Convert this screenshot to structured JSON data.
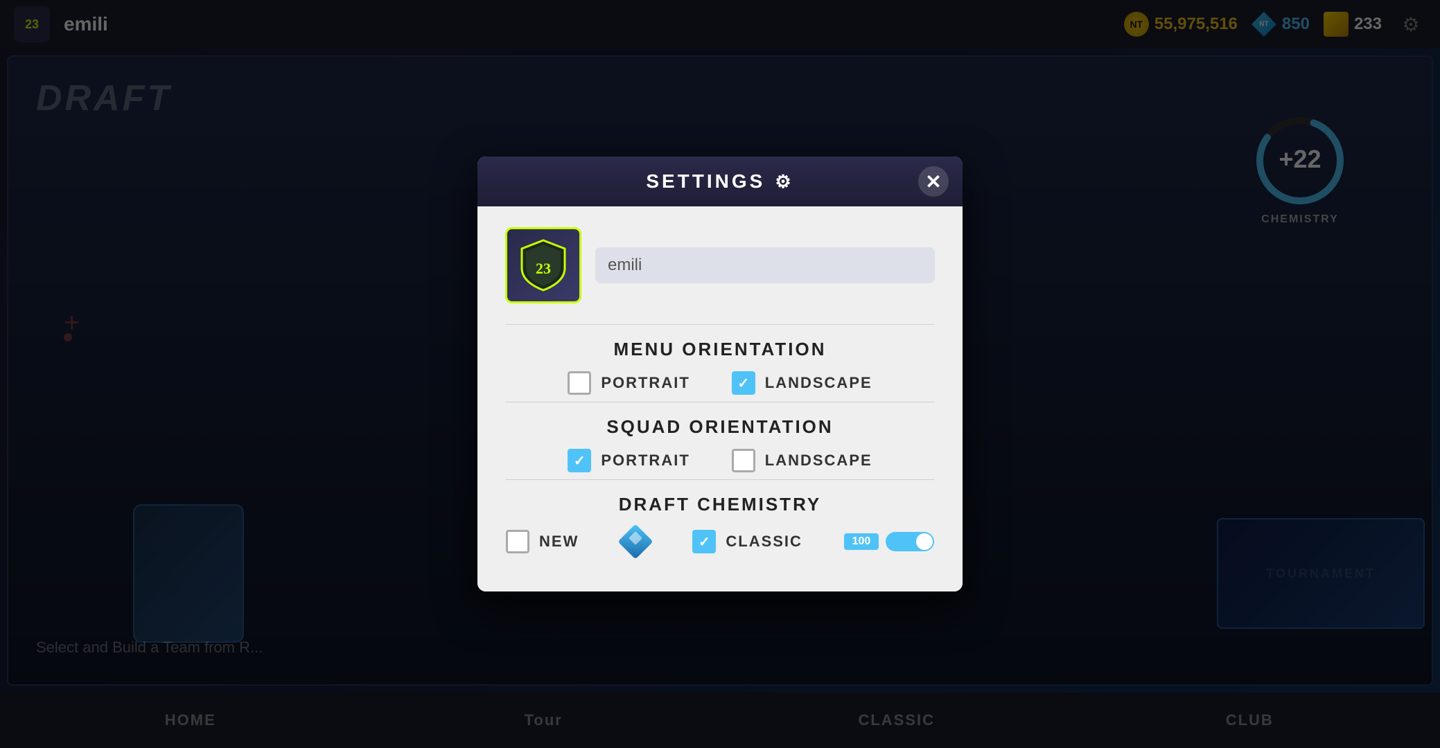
{
  "topbar": {
    "badge_number": "23",
    "username": "emili",
    "coins": "55,975,516",
    "pts": "850",
    "fifa_points": "233"
  },
  "background": {
    "draft_title": "DRAFT",
    "draft_subtitle": "Select and Build a Team from R...",
    "chemistry_value": "+22",
    "chemistry_label": "CHEMISTRY"
  },
  "bottom_nav": {
    "items": [
      {
        "label": "HOME",
        "active": false
      },
      {
        "label": "Tour",
        "active": false
      },
      {
        "label": "CLASSIC",
        "active": false
      },
      {
        "label": "CLUB",
        "active": false
      }
    ]
  },
  "modal": {
    "title": "SETTINGS",
    "close_label": "✕",
    "gear_icon": "⚙",
    "profile": {
      "username_value": "emili",
      "username_placeholder": "emili"
    },
    "menu_orientation": {
      "section_title": "MENU ORIENTATION",
      "portrait": {
        "label": "PORTRAIT",
        "checked": false
      },
      "landscape": {
        "label": "LANDSCAPE",
        "checked": true
      }
    },
    "squad_orientation": {
      "section_title": "SQUAD ORIENTATION",
      "portrait": {
        "label": "PORTRAIT",
        "checked": true
      },
      "landscape": {
        "label": "LANDSCAPE",
        "checked": false
      }
    },
    "draft_chemistry": {
      "section_title": "DRAFT CHEMISTRY",
      "new_option": {
        "label": "NEW",
        "checked": false
      },
      "classic_option": {
        "label": "CLASSIC",
        "checked": true
      },
      "toggle_value": "100"
    }
  }
}
